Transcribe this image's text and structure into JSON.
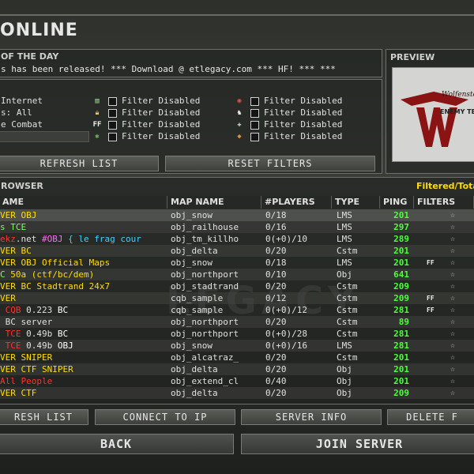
{
  "title": "ONLINE",
  "motd": {
    "header": "OF THE DAY",
    "text": "s has been released! *** Download @ etlegacy.com *** HF! ***  ***"
  },
  "preview": {
    "header": "PREVIEW",
    "image_text_top": "Wolfenstein",
    "image_text_main": "ENEMY TERRITORY"
  },
  "filters": {
    "source": [
      {
        "label": "Internet"
      },
      {
        "label": "s: All"
      },
      {
        "label": "e Combat"
      }
    ],
    "column1": [
      {
        "icon": "password-icon",
        "label": "Filter Disabled"
      },
      {
        "icon": "lock-icon",
        "label": "Filter Disabled"
      },
      {
        "icon": "friendly-fire-icon",
        "label": "Filter Disabled"
      },
      {
        "icon": "antilag-icon",
        "label": "Filter Disabled"
      }
    ],
    "column2": [
      {
        "icon": "punkbuster-icon",
        "label": "Filter Disabled"
      },
      {
        "icon": "teamplay-icon",
        "label": "Filter Disabled"
      },
      {
        "icon": "weapon-icon",
        "label": "Filter Disabled"
      },
      {
        "icon": "balance-icon",
        "label": "Filter Disabled"
      }
    ]
  },
  "buttons": {
    "refresh_list": "REFRESH LIST",
    "reset_filters": "RESET FILTERS",
    "refresh_list_bottom": "RESH LIST",
    "connect_to_ip": "CONNECT TO IP",
    "server_info": "SERVER INFO",
    "delete_f": "DELETE F",
    "back": "BACK",
    "join_server": "JOIN SERVER"
  },
  "browser": {
    "header": "ROWSER",
    "filtered_total": "Filtered/Total",
    "columns": [
      "AME",
      "MAP NAME",
      "#PLAYERS",
      "TYPE",
      "PING",
      "FILTERS"
    ],
    "rows": [
      {
        "name": [
          {
            "t": "VER OBJ",
            "c": "#ffdd00"
          }
        ],
        "map": "obj_snow",
        "players": "0/18",
        "type": "LMS",
        "ping": "201",
        "ff": false
      },
      {
        "name": [
          {
            "t": "s TCE",
            "c": "#7cff5a"
          }
        ],
        "map": "obj_railhouse",
        "players": "0/16",
        "type": "LMS",
        "ping": "297",
        "ff": false
      },
      {
        "name": [
          {
            "t": "e",
            "c": "#ff3030"
          },
          {
            "t": "kz",
            "c": "#ff3030"
          },
          {
            "t": ".net ",
            "c": "#e0e0e0"
          },
          {
            "t": "#OBJ",
            "c": "#ff66ff"
          },
          {
            "t": " { le frag cour",
            "c": "#44ccff"
          }
        ],
        "map": "obj_tm_killho",
        "players": "0(+0)/10",
        "type": "LMS",
        "ping": "289",
        "ff": false
      },
      {
        "name": [
          {
            "t": "VER BC",
            "c": "#ffdd00"
          }
        ],
        "map": "obj_delta",
        "players": "0/20",
        "type": "Cstm",
        "ping": "201",
        "ff": false
      },
      {
        "name": [
          {
            "t": "VER OBJ Official Maps",
            "c": "#ffdd00"
          }
        ],
        "map": "obj_snow",
        "players": "0/18",
        "type": "LMS",
        "ping": "201",
        "ff": true
      },
      {
        "name": [
          {
            "t": "C ",
            "c": "#7cff5a"
          },
          {
            "t": "50a (ctf/bc/dem)",
            "c": "#ffdd00"
          }
        ],
        "map": "obj_northport",
        "players": "0/10",
        "type": "Obj",
        "ping": "641",
        "ff": false
      },
      {
        "name": [
          {
            "t": "VER BC Stadtrand 24x7",
            "c": "#ffdd00"
          }
        ],
        "map": "obj_stadtrand",
        "players": "0/20",
        "type": "Cstm",
        "ping": "209",
        "ff": false
      },
      {
        "name": [
          {
            "t": "VER",
            "c": "#ffdd00"
          }
        ],
        "map": "cqb_sample",
        "players": "0/12",
        "type": "Cstm",
        "ping": "209",
        "ff": true
      },
      {
        "name": [
          {
            "t": " CQB",
            "c": "#ff3030"
          },
          {
            "t": " 0.223 ",
            "c": "#e0e0e0"
          },
          {
            "t": "BC",
            "c": "#ffffff"
          }
        ],
        "map": "cqb_sample",
        "players": "0(+0)/12",
        "type": "Cstm",
        "ping": "281",
        "ff": true
      },
      {
        "name": [
          {
            "t": " BC server",
            "c": "#e0e0e0"
          }
        ],
        "map": "obj_northport",
        "players": "0/20",
        "type": "Cstm",
        "ping": "89",
        "ff": false
      },
      {
        "name": [
          {
            "t": " TCE",
            "c": "#ff3030"
          },
          {
            "t": " 0.49b ",
            "c": "#e0e0e0"
          },
          {
            "t": "BC",
            "c": "#ffffff"
          }
        ],
        "map": "obj_northport",
        "players": "0(+0)/28",
        "type": "Cstm",
        "ping": "281",
        "ff": false
      },
      {
        "name": [
          {
            "t": " TCE",
            "c": "#ff3030"
          },
          {
            "t": " 0.49b ",
            "c": "#e0e0e0"
          },
          {
            "t": "OBJ",
            "c": "#ffffff"
          }
        ],
        "map": "obj_snow",
        "players": "0(+0)/16",
        "type": "LMS",
        "ping": "281",
        "ff": false
      },
      {
        "name": [
          {
            "t": "VER SNIPER",
            "c": "#ffdd00"
          }
        ],
        "map": "obj_alcatraz_",
        "players": "0/20",
        "type": "Cstm",
        "ping": "201",
        "ff": false
      },
      {
        "name": [
          {
            "t": "VER CTF SNIPER",
            "c": "#ffdd00"
          }
        ],
        "map": "obj_delta",
        "players": "0/20",
        "type": "Obj",
        "ping": "201",
        "ff": false
      },
      {
        "name": [
          {
            "t": "All People",
            "c": "#ff3030"
          }
        ],
        "map": "obj_extend_cl",
        "players": "0/40",
        "type": "Obj",
        "ping": "201",
        "ff": false
      },
      {
        "name": [
          {
            "t": "VER CTF",
            "c": "#ffdd00"
          }
        ],
        "map": "obj_delta",
        "players": "0/20",
        "type": "Obj",
        "ping": "209",
        "ff": false
      }
    ]
  },
  "watermark": "LEGACY",
  "colors": {
    "ping": "#4cff3a",
    "accent": "#ffdd00"
  }
}
